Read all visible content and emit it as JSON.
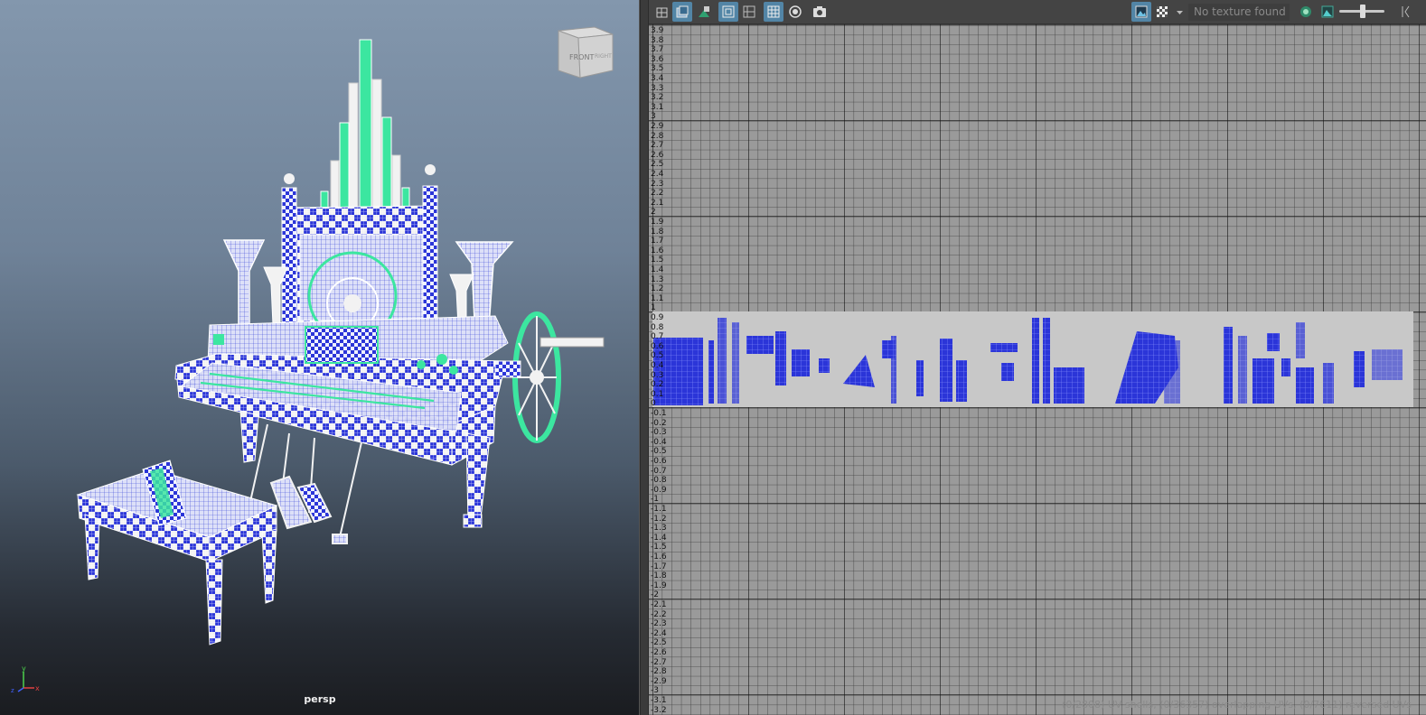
{
  "viewport": {
    "camera_label": "persp",
    "view_cube": {
      "front_label": "FRONT",
      "right_label": "RIGHT"
    },
    "axis": {
      "x_label": "x",
      "y_label": "y",
      "z_label": "z"
    },
    "colors": {
      "checker_blue": "#2b35d8",
      "highlight_green": "#3ce6a0",
      "wire_white": "#f2f2f2"
    }
  },
  "uv_editor": {
    "toolbar": {
      "icons": [
        "uv-toggle-icon",
        "shaded-uv-icon",
        "distortion-icon",
        "grid-toggle-icon",
        "pixel-snap-icon",
        "checker-grid-icon",
        "isolate-icon",
        "snapshot-icon",
        "display-image-icon",
        "checker-tile-icon",
        "dropdown-icon",
        "texture-field",
        "uv-filter-icon",
        "image-options-icon",
        "zoom-slider",
        "panel-arrows-icon"
      ],
      "texture_placeholder": "No texture found"
    },
    "ruler_ticks": [
      "3.9",
      "3.8",
      "3.7",
      "3.6",
      "3.5",
      "3.4",
      "3.3",
      "3.2",
      "3.1",
      "3",
      "2.9",
      "2.8",
      "2.7",
      "2.6",
      "2.5",
      "2.4",
      "2.3",
      "2.2",
      "2.1",
      "2",
      "1.9",
      "1.8",
      "1.7",
      "1.6",
      "1.5",
      "1.4",
      "1.3",
      "1.2",
      "1.1",
      "1",
      "0.9",
      "0.8",
      "0.7",
      "0.6",
      "0.5",
      "0.4",
      "0.3",
      "0.2",
      "0.1",
      "0",
      "-0.1",
      "-0.2",
      "-0.3",
      "-0.4",
      "-0.5",
      "-0.6",
      "-0.7",
      "-0.8",
      "-0.9",
      "-1",
      "-1.1",
      "-1.2",
      "-1.3",
      "-1.4",
      "-1.5",
      "-1.6",
      "-1.7",
      "-1.8",
      "-1.9",
      "-2",
      "-2.1",
      "-2.2",
      "-2.3",
      "-2.4",
      "-2.5",
      "-2.6",
      "-2.7",
      "-2.8",
      "-2.9",
      "-3",
      "-3.1",
      "-3.2"
    ],
    "status_text": "(0/2808) UV shells, (0/36357) overlapping UVs, (0/7611) reversed UVs",
    "colors": {
      "grid_bg": "#9a9a9a",
      "grid_minor": "#3c3c3c",
      "grid_major": "#111111",
      "uv_strip": "#c8c8c8",
      "uv_fill": "#2b35d8"
    }
  }
}
